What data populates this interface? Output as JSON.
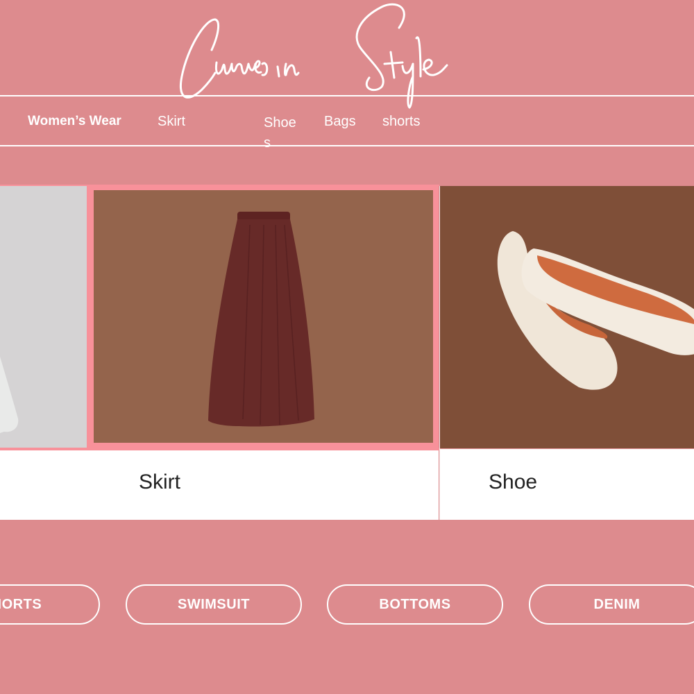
{
  "colors": {
    "background": "#dd8b8e",
    "highlight_border": "#f8919a",
    "text_light": "#ffffff",
    "caption_text": "#222222"
  },
  "logo": {
    "text": "Curves in Style"
  },
  "nav": {
    "brand": "Women’s Wear",
    "items": [
      {
        "label": "Skirt"
      },
      {
        "label": "Shoes"
      },
      {
        "label": "Bags"
      },
      {
        "label": "shorts"
      }
    ]
  },
  "gallery": {
    "cards": [
      {
        "label": "",
        "image": "white-garment-image",
        "background": "#d5d3d4"
      },
      {
        "label": "Skirt",
        "image": "maroon-skirt-image",
        "background": "#94644c",
        "selected": true
      },
      {
        "label": "Shoe",
        "image": "cream-ballet-flats-image",
        "background": "#7f4f38"
      }
    ]
  },
  "categories": [
    {
      "label": "SHORTS"
    },
    {
      "label": "SWIMSUIT"
    },
    {
      "label": "BOTTOMS"
    },
    {
      "label": "DENIM"
    }
  ]
}
